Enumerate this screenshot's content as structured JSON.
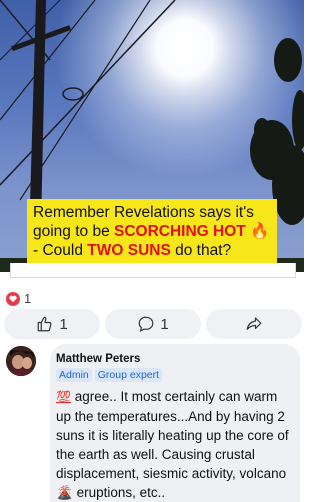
{
  "post": {
    "caption_part1": "Remember Revelations says it's going to be ",
    "caption_hot": "SCORCHING HOT",
    "caption_fire": "🔥",
    "caption_dash": " - Could ",
    "caption_two_suns": "TWO SUNS",
    "caption_end": " do that?",
    "colors": {
      "caption_bg": "#f7e61a",
      "highlight": "#e01010"
    }
  },
  "reactions": {
    "icon": "heart-icon",
    "count": "1"
  },
  "actions": {
    "like_count": "1",
    "comment_count": "1"
  },
  "comment": {
    "author": "Matthew Peters",
    "badges": [
      "Admin",
      "Group expert"
    ],
    "emoji_100": "💯",
    "text_1": " agree.. It most certainly can warm up the temperatures...And by having 2 suns it is literally heating up the core of the earth as well. Causing crustal displacement, siesmic activity, volcano ",
    "volcano_emoji": "🌋",
    "text_2": " eruptions, etc.."
  }
}
